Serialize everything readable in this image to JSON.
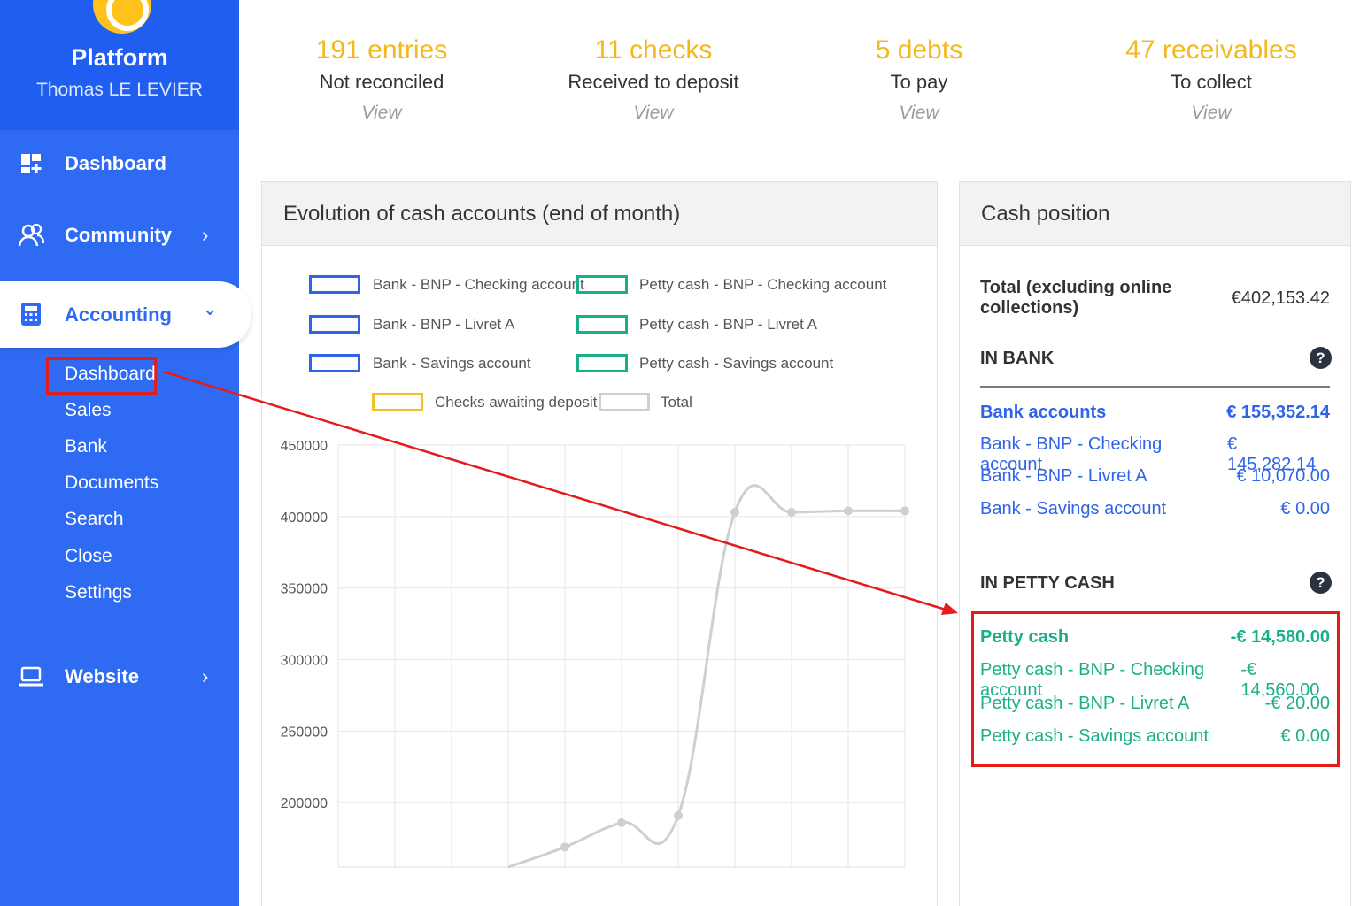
{
  "sidebar": {
    "brand": "Platform",
    "user": "Thomas LE LEVIER",
    "nav": [
      {
        "label": "Dashboard"
      },
      {
        "label": "Community",
        "chevron": "›"
      },
      {
        "label": "Accounting",
        "chevron": "⌄"
      },
      {
        "label": "Website",
        "chevron": "›"
      }
    ],
    "accounting_sub": [
      "Dashboard",
      "Sales",
      "Bank",
      "Documents",
      "Search",
      "Close",
      "Settings"
    ]
  },
  "stats": [
    {
      "value": "191 entries",
      "label": "Not reconciled",
      "link": "View"
    },
    {
      "value": "11 checks",
      "label": "Received to deposit",
      "link": "View"
    },
    {
      "value": "5 debts",
      "label": "To pay",
      "link": "View"
    },
    {
      "value": "47 receivables",
      "label": "To collect",
      "link": "View"
    }
  ],
  "evolution": {
    "title": "Evolution of cash accounts (end of month)",
    "legend": [
      {
        "label": "Bank - BNP - Checking account",
        "color": "#2f63e8"
      },
      {
        "label": "Bank - BNP - Livret A",
        "color": "#2f63e8"
      },
      {
        "label": "Bank - Savings account",
        "color": "#2f63e8"
      },
      {
        "label": "Petty cash - BNP - Checking account",
        "color": "#19b089"
      },
      {
        "label": "Petty cash - BNP - Livret A",
        "color": "#19b089"
      },
      {
        "label": "Petty cash - Savings account",
        "color": "#19b089"
      },
      {
        "label": "Checks awaiting deposit",
        "color": "#f4c02a"
      },
      {
        "label": "Total",
        "color": "#cfcfcf"
      }
    ]
  },
  "chart_data": {
    "type": "line",
    "title": "Evolution of cash accounts (end of month)",
    "ylim": [
      155000,
      450000
    ],
    "y_ticks": [
      "450000",
      "400000",
      "350000",
      "300000",
      "250000",
      "200000"
    ],
    "y_tick_values": [
      450000,
      400000,
      350000,
      300000,
      250000,
      200000
    ],
    "x_count": 11,
    "grid": true,
    "series": [
      {
        "name": "Total",
        "color": "#cfcfcf",
        "x_index": [
          3,
          4,
          5,
          6,
          7,
          8,
          9,
          10
        ],
        "values": [
          155000,
          169000,
          186000,
          191000,
          403000,
          403000,
          404000,
          404000
        ]
      }
    ]
  },
  "cash": {
    "title": "Cash position",
    "total_label": "Total (excluding online collections)",
    "total_value": "€402,153.42",
    "bank_section": "IN BANK",
    "petty_section": "IN PETTY CASH",
    "help": "?",
    "bank_items": [
      {
        "label": "Bank accounts",
        "value": "€ 155,352.14",
        "head": true
      },
      {
        "label": "Bank - BNP - Checking account",
        "value": "€ 145,282.14"
      },
      {
        "label": "Bank - BNP - Livret A",
        "value": "€ 10,070.00"
      },
      {
        "label": "Bank - Savings account",
        "value": "€ 0.00"
      }
    ],
    "petty_items": [
      {
        "label": "Petty cash",
        "value": "-€ 14,580.00",
        "head": true
      },
      {
        "label": "Petty cash - BNP - Checking account",
        "value": "-€ 14,560.00"
      },
      {
        "label": "Petty cash - BNP - Livret A",
        "value": "-€ 20.00"
      },
      {
        "label": "Petty cash - Savings account",
        "value": "€ 0.00"
      }
    ]
  }
}
